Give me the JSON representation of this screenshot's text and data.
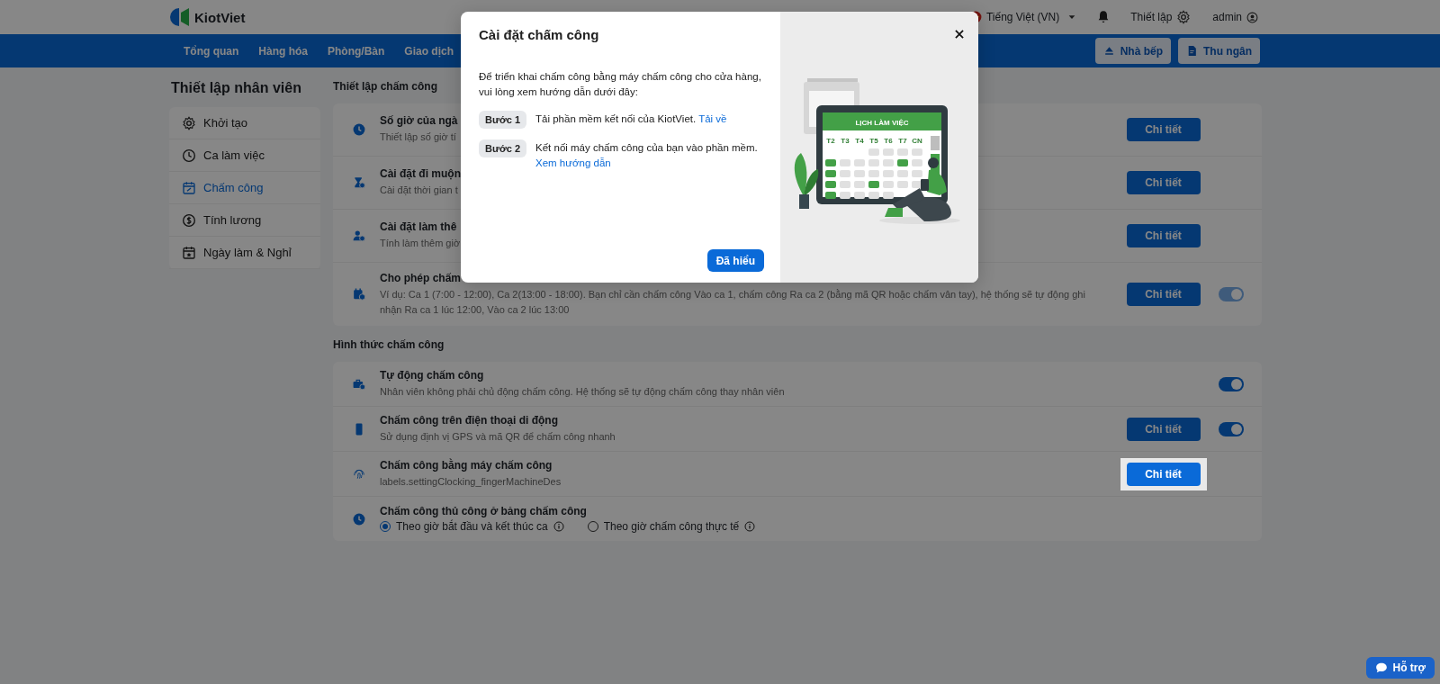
{
  "header": {
    "logo": "KiotViet",
    "language": "Tiếng Việt (VN)",
    "settings": "Thiết lập",
    "user": "admin"
  },
  "nav": {
    "items": [
      "Tổng quan",
      "Hàng hóa",
      "Phòng/Bàn",
      "Giao dịch"
    ],
    "buttons": [
      "Nhà bếp",
      "Thu ngân"
    ]
  },
  "sidebar": {
    "title": "Thiết lập nhân viên",
    "items": [
      {
        "label": "Khởi tạo",
        "selected": false
      },
      {
        "label": "Ca làm việc",
        "selected": false
      },
      {
        "label": "Chấm công",
        "selected": true
      },
      {
        "label": "Tính lương",
        "selected": false
      },
      {
        "label": "Ngày làm & Nghỉ",
        "selected": false
      }
    ]
  },
  "sections": [
    {
      "title": "Thiết lập chấm công",
      "rows": [
        {
          "kind": "setting",
          "title": "Số giờ của ngà",
          "description": "Thiết lập số giờ tí",
          "button": "Chi tiết"
        },
        {
          "kind": "setting",
          "title": "Cài đặt đi muộn",
          "description": "Cài đặt thời gian t",
          "button": "Chi tiết"
        },
        {
          "kind": "setting",
          "title": "Cài đặt làm thê",
          "description": "Tính làm thêm giờ",
          "button": "Chi tiết"
        },
        {
          "kind": "setting",
          "title": "Cho phép chấm",
          "description": "Ví dụ: Ca 1 (7:00 - 12:00), Ca 2(13:00 - 18:00). Bạn chỉ cần chấm công Vào ca 1, chấm công Ra ca 2 (bằng mã QR hoặc chấm vân tay), hệ thống sẽ tự động ghi nhận Ra ca 1 lúc 12:00, Vào ca 2 lúc 13:00",
          "button": "Chi tiết",
          "toggle": {
            "on": true,
            "disabled": true
          }
        }
      ]
    },
    {
      "title": "Hình thức chấm công",
      "rows": [
        {
          "kind": "setting",
          "title": "Tự động chấm công",
          "description": "Nhân viên không phải chủ động chấm công. Hệ thống sẽ tự động chấm công thay nhân viên",
          "toggle": {
            "on": true,
            "disabled": false
          }
        },
        {
          "kind": "setting",
          "title": "Chấm công trên điện thoại di động",
          "description": "Sử dụng định vị GPS và mã QR để chấm công nhanh",
          "button": "Chi tiết",
          "toggle": {
            "on": true,
            "disabled": false
          }
        },
        {
          "kind": "setting",
          "title": "Chấm công bằng máy chấm công",
          "description": "labels.settingClocking_fingerMachineDes",
          "button": "Chi tiết",
          "highlighted": true
        },
        {
          "kind": "radio",
          "title": "Chấm công thủ công ở bảng chấm công",
          "options": [
            {
              "label": "Theo giờ bắt đầu và kết thúc ca",
              "selected": true
            },
            {
              "label": "Theo giờ chấm công thực tế",
              "selected": false
            }
          ]
        }
      ]
    }
  ],
  "modal": {
    "title": "Cài đặt chấm công",
    "intro": "Để triển khai chấm công bằng máy chấm công cho cửa hàng, vui lòng xem hướng dẫn dưới đây:",
    "steps": [
      {
        "badge": "Bước 1",
        "text": "Tải phần mềm kết nối của KiotViet.",
        "link": "Tải về"
      },
      {
        "badge": "Bước 2",
        "text": "Kết nối máy chấm công của bạn vào phần mềm.",
        "link": "Xem hướng dẫn"
      }
    ],
    "confirm": "Đã hiểu",
    "illustration": {
      "heading": "LỊCH LÀM VIỆC",
      "weekdays": [
        "T2",
        "T3",
        "T4",
        "T5",
        "T6",
        "T7",
        "CN"
      ]
    }
  },
  "help": "Hỗ trợ"
}
